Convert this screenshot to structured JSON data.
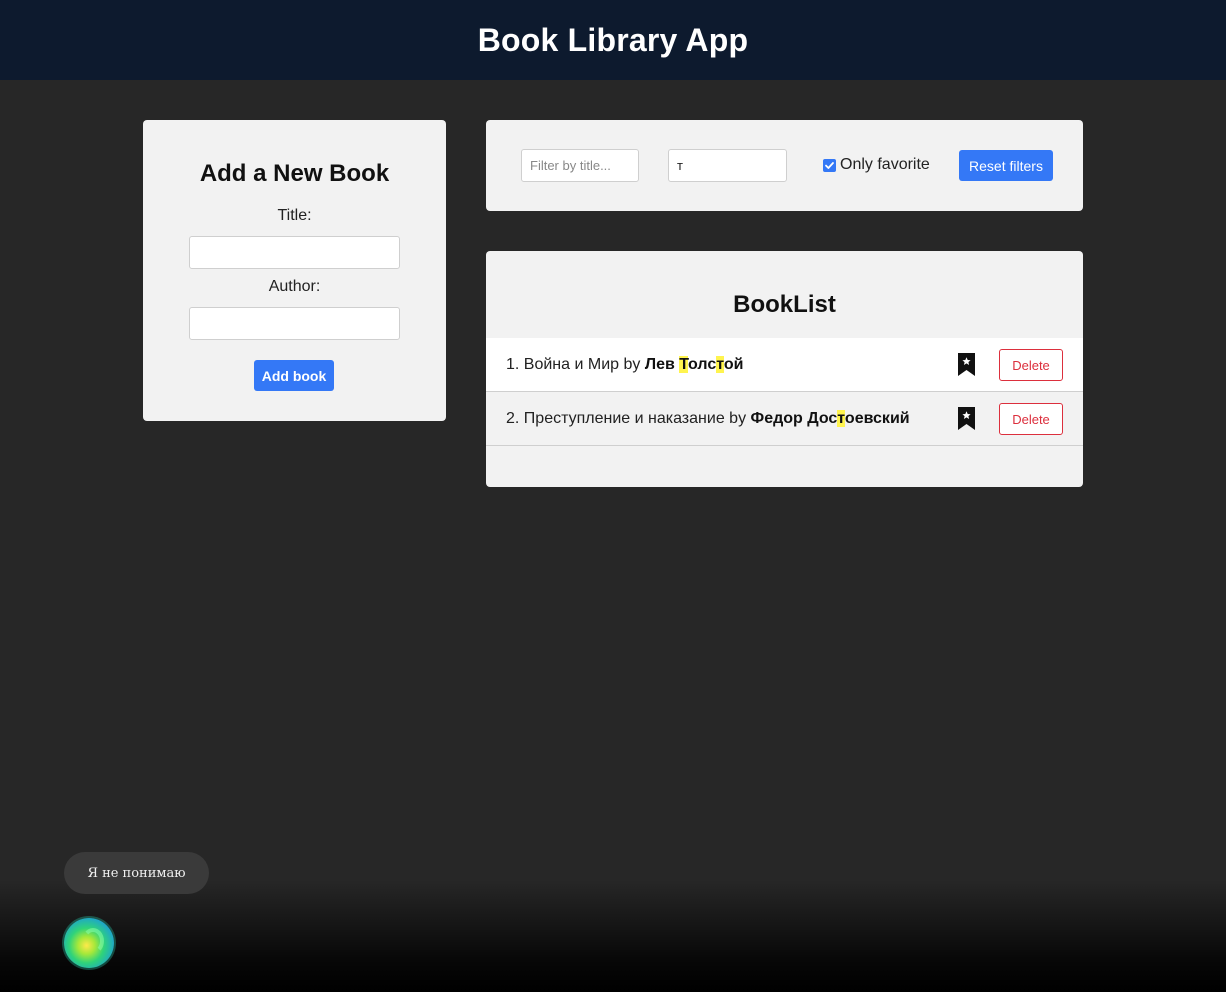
{
  "header": {
    "title": "Book Library App"
  },
  "add_form": {
    "title": "Add a New Book",
    "title_label": "Title:",
    "title_value": "",
    "author_label": "Author:",
    "author_value": "",
    "submit_label": "Add book"
  },
  "filters": {
    "title_filter": {
      "value": "",
      "placeholder": "Filter by title..."
    },
    "author_filter": {
      "value": "т",
      "placeholder": ""
    },
    "only_favorite_label": "Only favorite",
    "only_favorite_checked": true,
    "reset_label": "Reset filters"
  },
  "book_list": {
    "title": "BookList",
    "books": [
      {
        "index": "1.",
        "title": "Война и Мир",
        "by": "by",
        "author_parts": [
          "Лев ",
          "Т",
          "олс",
          "т",
          "ой"
        ],
        "favorite": true,
        "delete_label": "Delete"
      },
      {
        "index": "2.",
        "title": "Преступление и наказание",
        "by": "by",
        "author_parts": [
          "Федор Дос",
          "т",
          "оевский"
        ],
        "favorite": true,
        "delete_label": "Delete"
      }
    ]
  },
  "chat": {
    "message": "Я не понимаю"
  },
  "colors": {
    "header_bg": "#0d1a2e",
    "page_bg": "#272727",
    "card_bg": "#f2f2f2",
    "primary": "#3478f6",
    "danger": "#dc2f3d",
    "highlight": "#fff44f"
  }
}
